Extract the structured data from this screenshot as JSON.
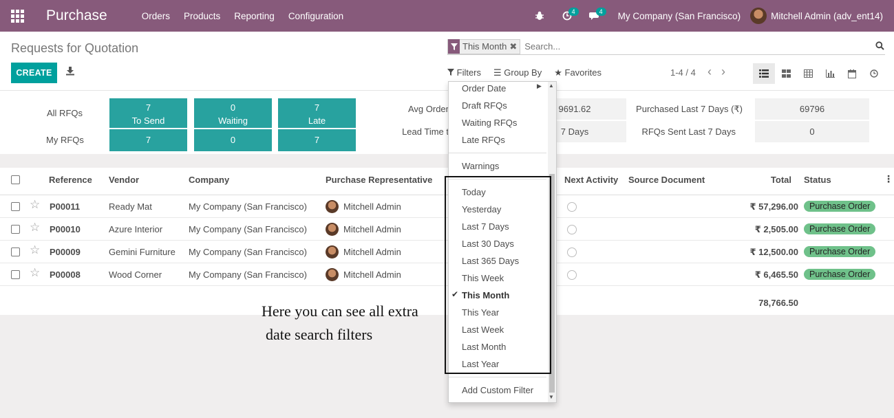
{
  "navbar": {
    "brand": "Purchase",
    "menu": [
      "Orders",
      "Products",
      "Reporting",
      "Configuration"
    ],
    "activity_count": "4",
    "message_count": "4",
    "company": "My Company (San Francisco)",
    "user": "Mitchell Admin (adv_ent14)"
  },
  "control": {
    "title": "Requests for Quotation",
    "create_label": "CREATE",
    "facet_value": "This Month",
    "search_placeholder": "Search...",
    "filters_label": "Filters",
    "groupby_label": "Group By",
    "favorites_label": "Favorites",
    "pager": "1-4 / 4"
  },
  "dashboard": {
    "all_rfqs_label": "All RFQs",
    "my_rfqs_label": "My RFQs",
    "to_send_count": "7",
    "to_send_label": "To Send",
    "waiting_count": "0",
    "waiting_label": "Waiting",
    "late_count": "7",
    "late_label": "Late",
    "my_to_send": "7",
    "my_waiting": "0",
    "my_late": "7",
    "avg_order_label": "Avg Order",
    "avg_order_value": "9691.62",
    "lead_time_label": "Lead Time t",
    "lead_time_value": "7  Days",
    "purchased_label": "Purchased Last 7 Days (₹)",
    "purchased_value": "69796",
    "rfq_sent_label": "RFQs Sent Last 7 Days",
    "rfq_sent_value": "0"
  },
  "table": {
    "headers": {
      "reference": "Reference",
      "vendor": "Vendor",
      "company": "Company",
      "representative": "Purchase Representative",
      "next_activity": "Next Activity",
      "source_document": "Source Document",
      "total": "Total",
      "status": "Status"
    },
    "rows": [
      {
        "reference": "P00011",
        "vendor": "Ready Mat",
        "company": "My Company (San Francisco)",
        "representative": "Mitchell Admin",
        "total": "₹ 57,296.00",
        "status": "Purchase Order"
      },
      {
        "reference": "P00010",
        "vendor": "Azure Interior",
        "company": "My Company (San Francisco)",
        "representative": "Mitchell Admin",
        "total": "₹ 2,505.00",
        "status": "Purchase Order"
      },
      {
        "reference": "P00009",
        "vendor": "Gemini Furniture",
        "company": "My Company (San Francisco)",
        "representative": "Mitchell Admin",
        "total": "₹ 12,500.00",
        "status": "Purchase Order"
      },
      {
        "reference": "P00008",
        "vendor": "Wood Corner",
        "company": "My Company (San Francisco)",
        "representative": "Mitchell Admin",
        "total": "₹ 6,465.50",
        "status": "Purchase Order"
      }
    ],
    "sum_total": "78,766.50"
  },
  "filters_dropdown": {
    "top_items": [
      "Order Date",
      "Draft RFQs",
      "Waiting RFQs",
      "Late RFQs"
    ],
    "warnings": "Warnings",
    "date_options": [
      "Today",
      "Yesterday",
      "Last 7 Days",
      "Last 30 Days",
      "Last 365 Days",
      "This Week",
      "This Month",
      "This Year",
      "Last Week",
      "Last Month",
      "Last Year"
    ],
    "selected_option": "This Month",
    "custom_filter": "Add Custom Filter"
  },
  "annotation": {
    "line1": "Here you can see all extra",
    "line2": "date search filters"
  },
  "colors": {
    "navbar": "#875a7b",
    "primary": "#00a09d",
    "tile": "#28a29f",
    "status_badge": "#6fc18a"
  }
}
